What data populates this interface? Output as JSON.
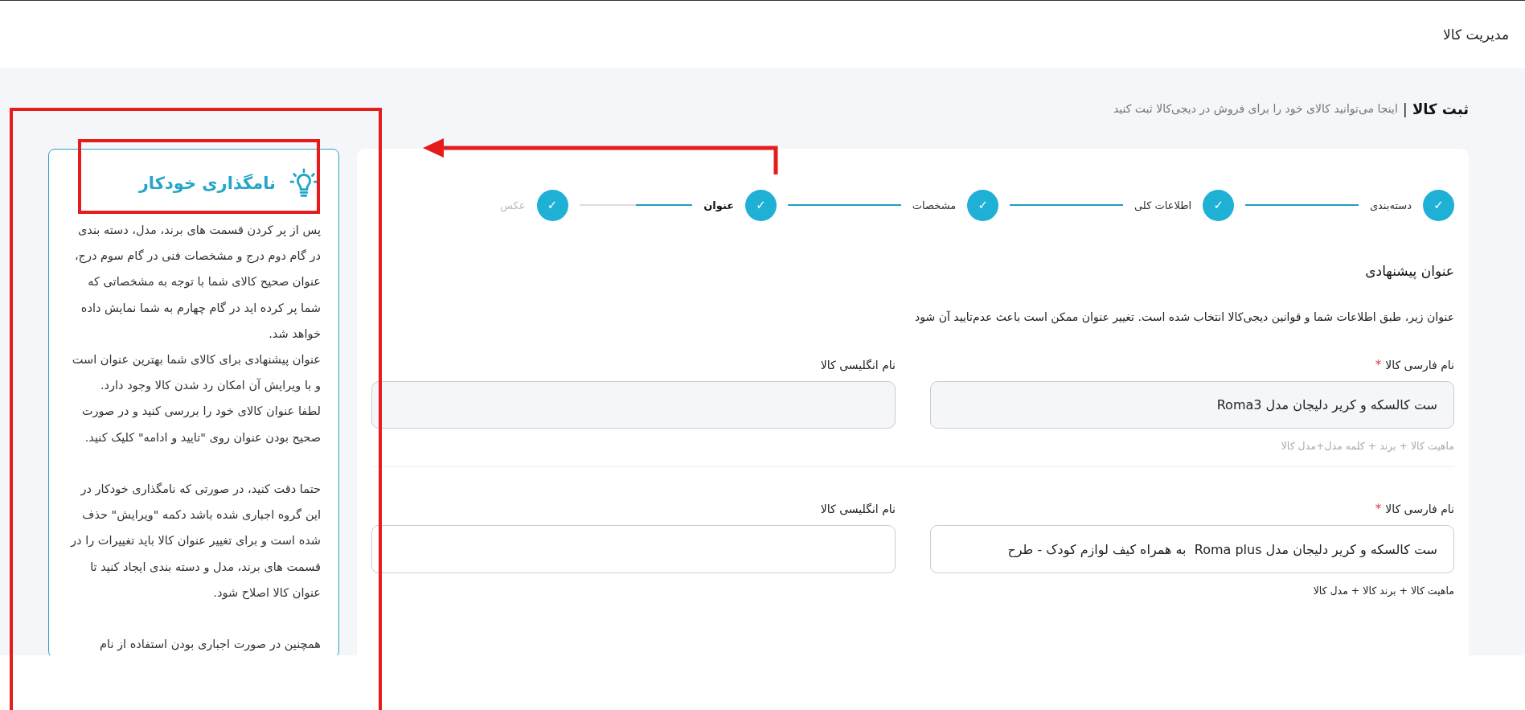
{
  "page_title": "مدیریت کالا",
  "header": {
    "title": "ثبت کالا",
    "separator": "|",
    "subtitle": "اینجا می‌توانید کالای خود را برای فروش در دیجی‌کالا ثبت کنید"
  },
  "steps": [
    {
      "label": "دسته‌بندی",
      "check": "✓",
      "completed": true,
      "current": false
    },
    {
      "label": "اطلاعات کلی",
      "check": "✓",
      "completed": true,
      "current": false
    },
    {
      "label": "مشخصات",
      "check": "✓",
      "completed": true,
      "current": false
    },
    {
      "label": "عنوان",
      "check": "✓",
      "completed": true,
      "current": true
    },
    {
      "label": "عکس",
      "check": "✓",
      "completed": false,
      "current": false
    }
  ],
  "section": {
    "title": "عنوان پیشنهادی",
    "description": "عنوان زیر، طبق اطلاعات شما و قوانین دیجی‌کالا انتخاب شده است. تغییر عنوان ممکن است باعث عدم‌تایید آن شود"
  },
  "field_rows": [
    {
      "persian_label": "نام فارسی کالا",
      "required_mark": "*",
      "persian_value": "ست کالسکه و کریر دلیجان مدل Roma3",
      "english_label": "نام انگلیسی کالا",
      "english_value": "",
      "hint": "ماهیت کالا + برند + کلمه مدل+مدل کالا",
      "hint_muted": true
    },
    {
      "persian_label": "نام فارسی کالا",
      "required_mark": "*",
      "persian_value": "ست کالسکه و کریر دلیجان مدل Roma plus  به همراه کیف لوازم کودک - طرح",
      "english_label": "نام انگلیسی کالا",
      "english_value": "",
      "hint": "ماهیت کالا + برند کالا + مدل کالا",
      "hint_muted": false
    }
  ],
  "help_panel": {
    "title": "نامگذاری خودکار",
    "paragraphs": [
      {
        "text": "پس از پر کردن قسمت های برند، مدل، دسته بندی در گام دوم درج و مشخصات فنی در گام سوم درج، عنوان صحیح کالای شما با توجه به مشخصاتی که شما پر کرده اید در گام چهارم به شما نمایش داده خواهد شد.",
        "gap_before": false
      },
      {
        "text": "عنوان پیشنهادی برای کالای شما بهترین عنوان است و با ویرایش آن امکان رد شدن کالا وجود دارد.",
        "gap_before": false
      },
      {
        "text": "لطفا عنوان کالای خود را بررسی کنید و در صورت صحیح بودن عنوان روی \"تایید و ادامه\" کلیک کنید.",
        "gap_before": false
      },
      {
        "text": "حتما دقت کنید، در صورتی که نامگذاری خودکار در این گروه اجباری شده باشد دکمه \"ویرایش\" حذف شده است و برای تغییر عنوان کالا باید تغییرات را در قسمت های برند، مدل و دسته بندی ایجاد کنید تا عنوان کالا اصلاح شود.",
        "gap_before": true
      },
      {
        "text": "همچنین در صورت اجباری بودن استفاده از نام",
        "gap_before": true
      }
    ]
  },
  "annotations": [
    {
      "kind": "box"
    },
    {
      "kind": "box"
    },
    {
      "kind": "arrow"
    }
  ]
}
